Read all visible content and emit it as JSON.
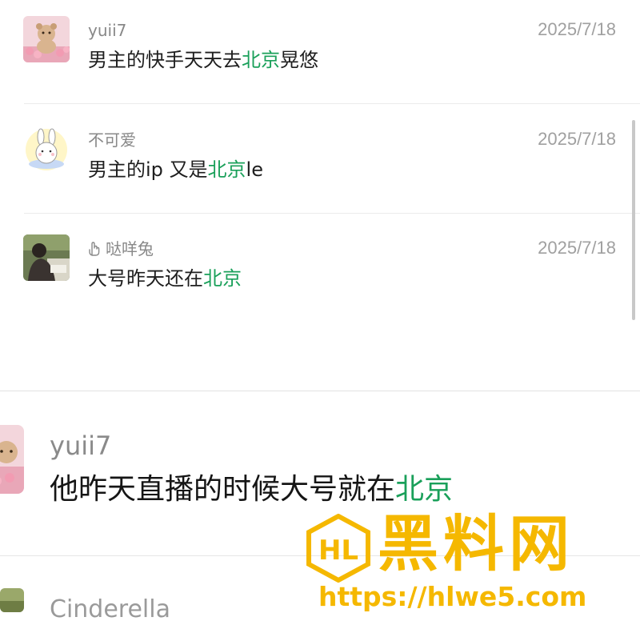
{
  "comments": [
    {
      "username": "yuii7",
      "date": "2025/7/18",
      "text_before": "男主的快手天天去",
      "keyword": "北京",
      "text_after": "晃悠",
      "avatar_icon": "teddy-bear-tulips-avatar"
    },
    {
      "username": "不可爱",
      "date": "2025/7/18",
      "text_before": "男主的ip 又是",
      "keyword": "北京",
      "text_after": "le",
      "avatar_icon": "cartoon-bunny-avatar"
    },
    {
      "username": "哒咩兔",
      "date": "2025/7/18",
      "text_before": "大号昨天还在",
      "keyword": "北京",
      "text_after": "",
      "avatar_icon": "person-photo-avatar",
      "badge_icon": "hand-icon"
    }
  ],
  "zoomed_comment": {
    "username": "yuii7",
    "text_before": "他昨天直播的时候大号就在",
    "keyword": "北京",
    "avatar_icon": "teddy-bear-tulips-avatar"
  },
  "partial_comment": {
    "username": "Cinderella",
    "avatar_icon": "landscape-avatar"
  },
  "watermark": {
    "title": "黑料网",
    "url": "https://hlwe5.com",
    "logo_text": "HL"
  },
  "colors": {
    "keyword": "#1aa05a",
    "date": "#a0a0a0",
    "username": "#888888",
    "watermark": "#f5b800"
  }
}
